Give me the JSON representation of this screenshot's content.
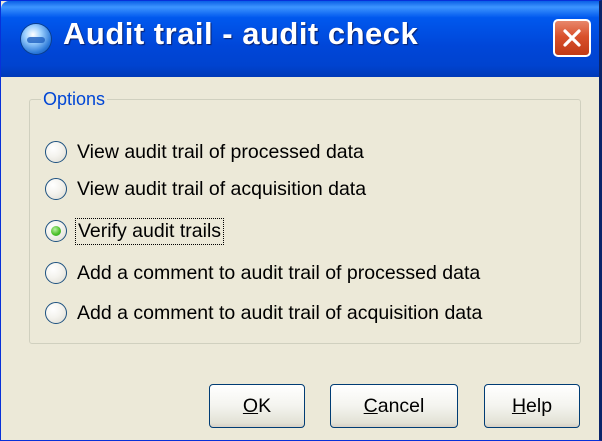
{
  "window": {
    "title": "Audit trail - audit check",
    "icon": "app-globe-icon",
    "close_icon": "close-x-icon"
  },
  "options_group": {
    "legend": "Options",
    "selected_index": 2,
    "items": [
      {
        "label": "View audit trail of processed data",
        "checked": false
      },
      {
        "label": "View audit trail of acquisition data",
        "checked": false
      },
      {
        "label": "Verify audit trails",
        "checked": true
      },
      {
        "label": "Add a comment to audit trail of processed data",
        "checked": false
      },
      {
        "label": "Add a comment to audit trail of acquisition data",
        "checked": false
      }
    ]
  },
  "buttons": {
    "ok": {
      "mnemonic": "O",
      "rest": "K"
    },
    "cancel": {
      "mnemonic": "C",
      "rest": "ancel"
    },
    "help": {
      "mnemonic": "H",
      "rest": "elp"
    }
  },
  "colors": {
    "titlebar": "#0058ee",
    "legend_text": "#0046d5",
    "dialog_bg": "#ece9d8",
    "close_button": "#d9512c"
  }
}
